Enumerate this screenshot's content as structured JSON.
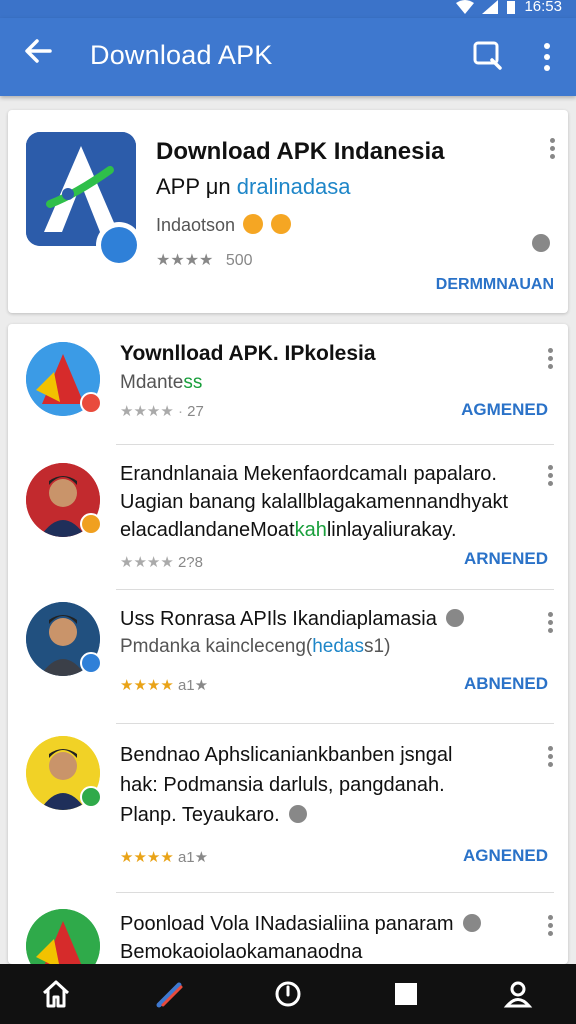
{
  "status_bar": {
    "time": "16:53"
  },
  "app_bar": {
    "title": "Download APK"
  },
  "featured": {
    "title_line1": "Download APK Indanesia",
    "title_line2_prefix": "APP μn",
    "title_line2_accent": "dralinadasa",
    "developer": "Indaotson",
    "rating_value": "500",
    "action_label": "DERMMNAUAN"
  },
  "items": [
    {
      "line1": "Yownlload APK. IPkolesia",
      "line2_a": "Mdante",
      "line2_b": "ss",
      "rating_value": "27",
      "action_label": "AGMENED"
    },
    {
      "line1": "Erandnlanaia Mekenfaordcamalı papalaro.",
      "line2": "Uagian banang kalallblagakamennandhyakt",
      "line3_a": "elacadlandaneMoat",
      "line3_b": "kah",
      "line3_c": "linlayaliurakay.",
      "rating_value": "2?8",
      "action_label": "ARNENED"
    },
    {
      "line1": "Uss Ronrasa APIls Ikandiaplamasia",
      "line2_a": "Pmdanka kaincleceng(",
      "line2_b": "hedas",
      "line2_c": "s1)",
      "rating_value": "a1★",
      "action_label": "ABNENED"
    },
    {
      "line1": "Bendnao Aphslicaniankbanben jsngal",
      "line2": "hak: Podmansia darluls, pangdanah.",
      "line3": "Planp. Teyaukaro.",
      "rating_value": "a1★",
      "action_label": "AGNENED"
    },
    {
      "line1": "Poonload Vola INadasialiina panaram",
      "line2": "Bemokaoiolaokamanaodna"
    }
  ],
  "colors": {
    "app_bar": "#3e78cf",
    "accent_blue": "#2a72c8",
    "star_gold": "#e9a317"
  },
  "icons": [
    "back-arrow-icon",
    "search-icon",
    "more-vert-icon",
    "home-icon",
    "brush-icon",
    "power-icon",
    "square-icon",
    "profile-icon"
  ]
}
